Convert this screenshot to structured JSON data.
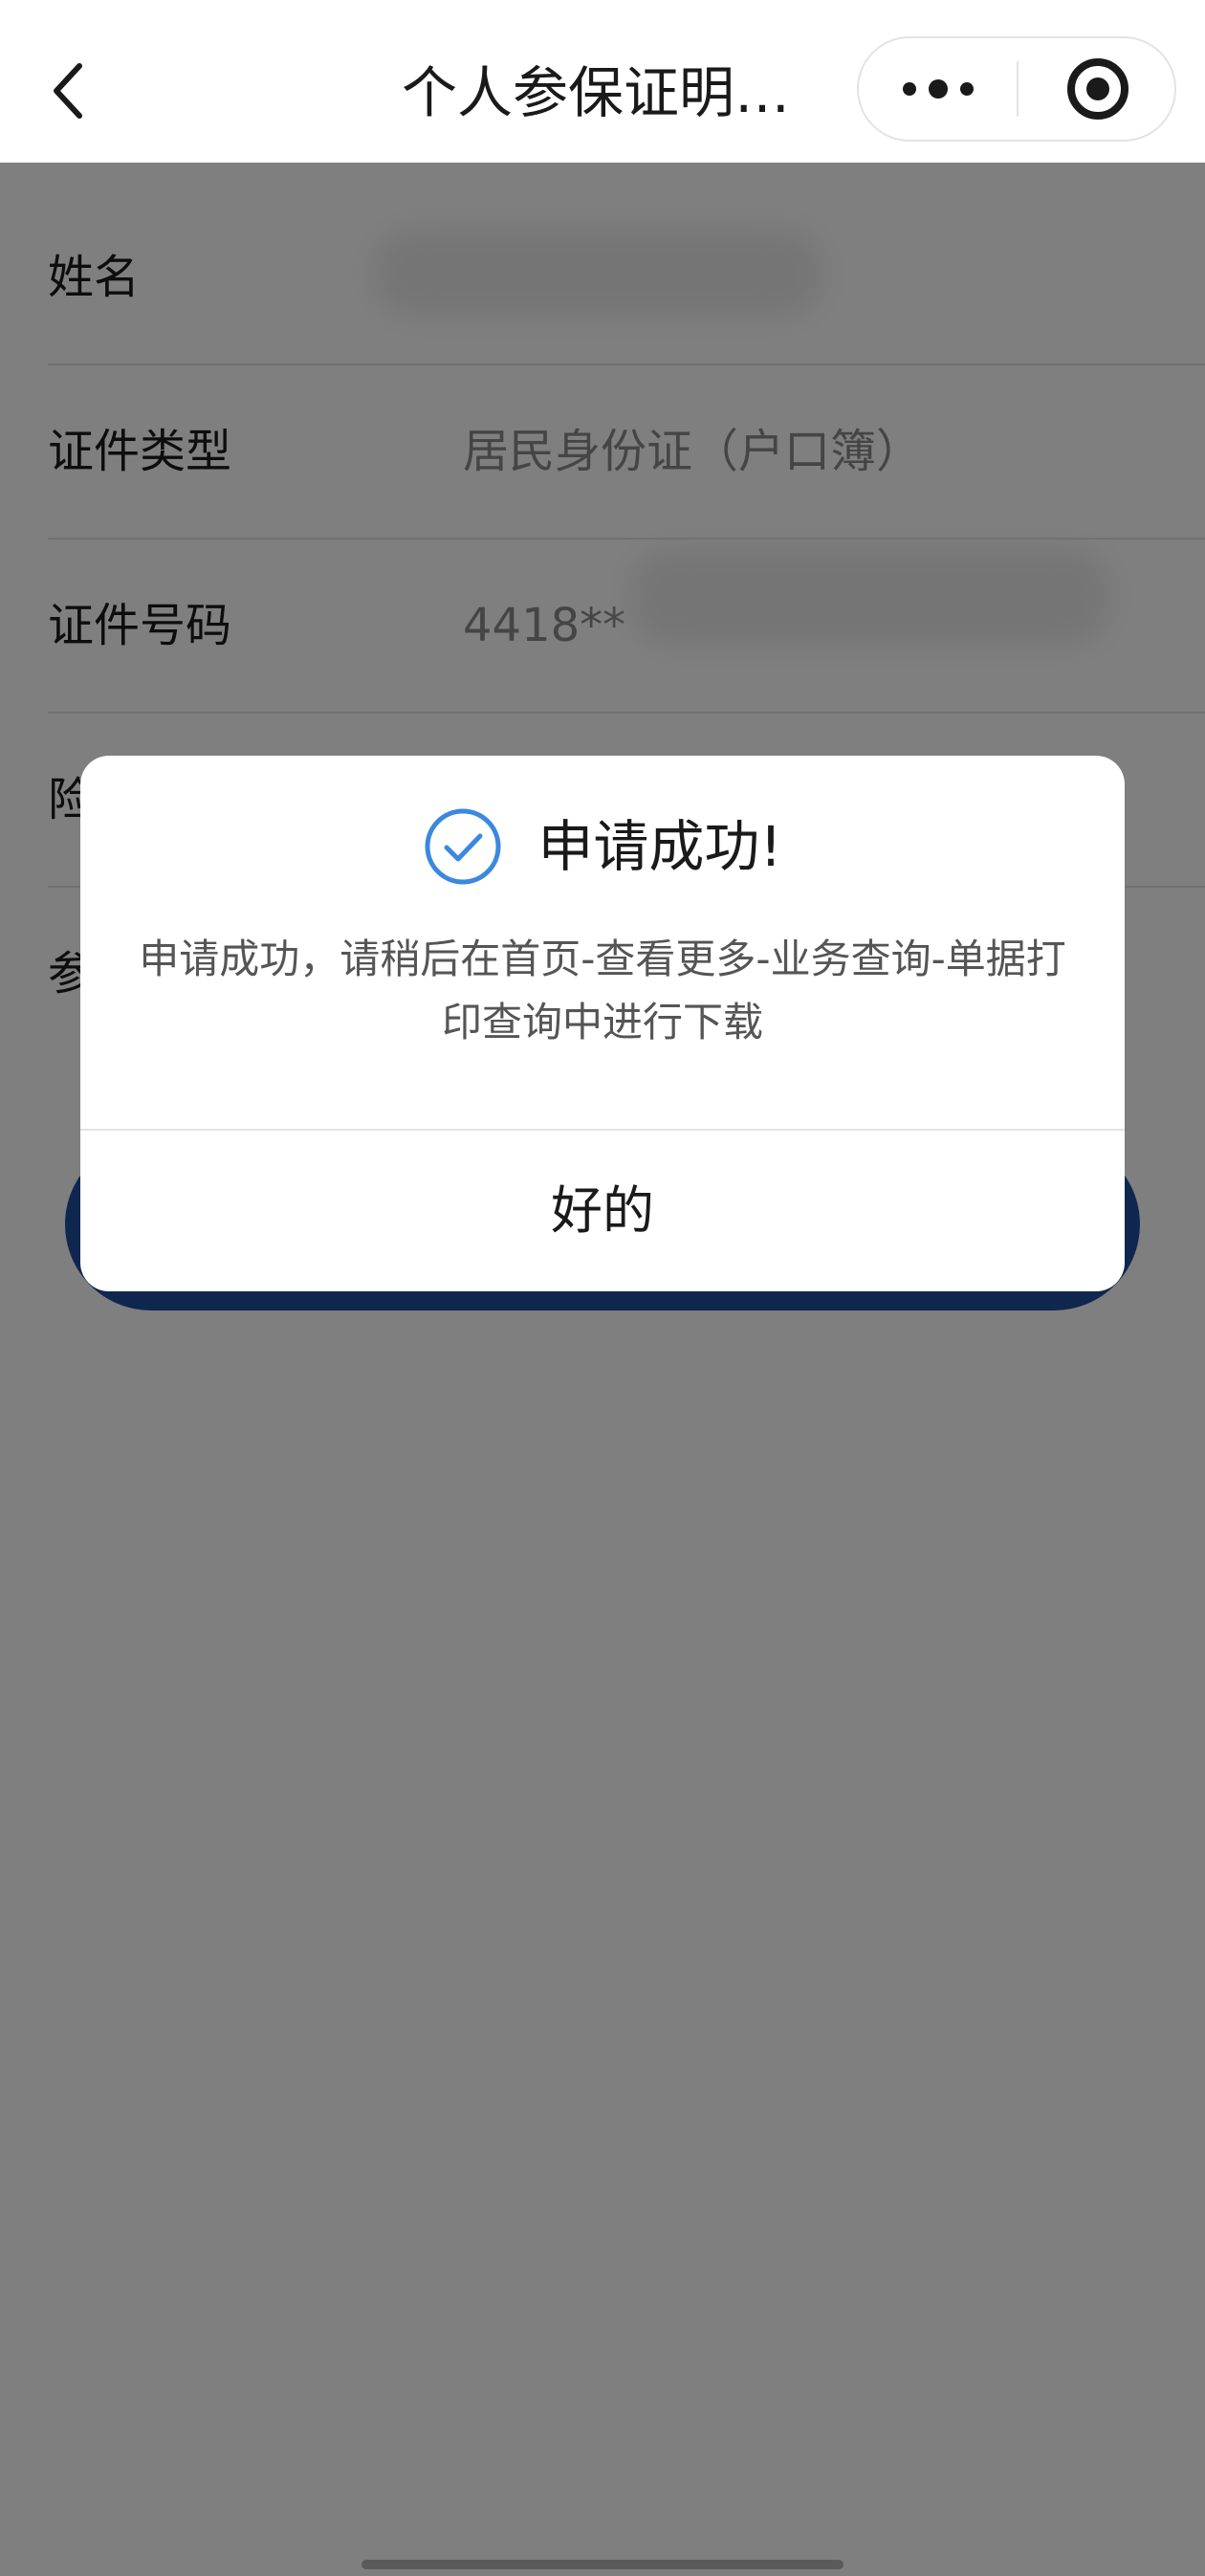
{
  "header": {
    "title": "个人参保证明…"
  },
  "form": {
    "rows": [
      {
        "label": "姓名",
        "value": ""
      },
      {
        "label": "证件类型",
        "value": "居民身份证（户口簿）"
      },
      {
        "label": "证件号码",
        "value": "4418**"
      },
      {
        "label": "险",
        "value": ""
      },
      {
        "label": "参",
        "value": ""
      }
    ]
  },
  "dialog": {
    "title": "申请成功!",
    "message": "申请成功，请稍后在首页-查看更多-业务查询-单据打印查询中进行下载",
    "confirm_label": "好的"
  },
  "colors": {
    "accent_blue": "#1f4f9c",
    "success_icon": "#3b88e0",
    "overlay": "rgba(0,0,0,0.5)"
  },
  "icons": {
    "back": "chevron-left-icon",
    "more": "more-dots-icon",
    "close": "target-close-icon",
    "success": "check-circle-icon"
  }
}
